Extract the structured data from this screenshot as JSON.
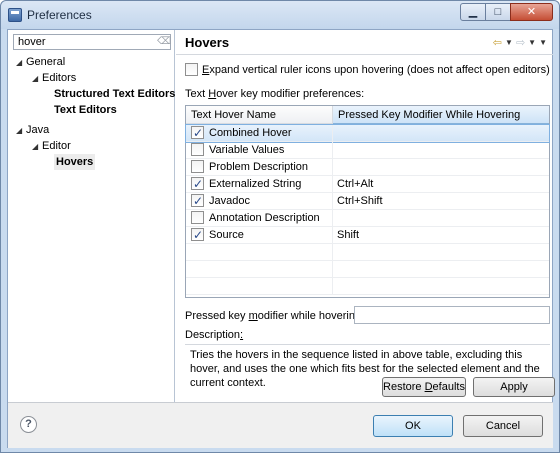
{
  "window": {
    "title": "Preferences",
    "min": "▁",
    "max": "□",
    "close": "✕"
  },
  "filter": {
    "value": "hover"
  },
  "tree": [
    {
      "label": "General",
      "level": 0,
      "twisty": "◢",
      "bold": false
    },
    {
      "label": "Editors",
      "level": 1,
      "twisty": "◢",
      "bold": false
    },
    {
      "label": "Structured Text Editors",
      "level": 2,
      "twisty": "",
      "bold": true
    },
    {
      "label": "Text Editors",
      "level": 2,
      "twisty": "",
      "bold": true
    },
    {
      "label": "Java",
      "level": 0,
      "twisty": "◢",
      "bold": false
    },
    {
      "label": "Editor",
      "level": 1,
      "twisty": "◢",
      "bold": false
    },
    {
      "label": "Hovers",
      "level": 2,
      "twisty": "",
      "bold": true,
      "selected": true
    }
  ],
  "page": {
    "title": "Hovers",
    "expand_label_pre": "",
    "expand_label_u": "E",
    "expand_label_post": "xpand vertical ruler icons upon hovering (does not affect open editors)",
    "table_label_pre": "Text ",
    "table_label_u": "H",
    "table_label_post": "over key modifier preferences:",
    "columns": [
      "Text Hover Name",
      "Pressed Key Modifier While Hovering"
    ],
    "rows": [
      {
        "name": "Combined Hover",
        "modifier": "",
        "checked": true,
        "selected": true
      },
      {
        "name": "Variable Values",
        "modifier": "",
        "checked": false
      },
      {
        "name": "Problem Description",
        "modifier": "",
        "checked": false
      },
      {
        "name": "Externalized String",
        "modifier": "Ctrl+Alt",
        "checked": true
      },
      {
        "name": "Javadoc",
        "modifier": "Ctrl+Shift",
        "checked": true
      },
      {
        "name": "Annotation Description",
        "modifier": "",
        "checked": false
      },
      {
        "name": "Source",
        "modifier": "Shift",
        "checked": true
      }
    ],
    "pressed_label_pre": "Pressed key ",
    "pressed_label_u": "m",
    "pressed_label_post": "odifier while hovering:",
    "pressed_value": "",
    "desc_label_pre": "Description",
    "desc_label_u": ":",
    "description": "Tries the hovers in the sequence listed in above table, excluding this hover, and uses the one which fits best for the selected element and the current context.",
    "restore_pre": "Restore ",
    "restore_u": "D",
    "restore_post": "efaults",
    "apply_label": "Apply"
  },
  "footer": {
    "ok": "OK",
    "cancel": "Cancel",
    "help": "?"
  },
  "colors": {
    "selection": "#d3e6f8",
    "title_bg": "#c9dbef",
    "close": "#c54e35"
  }
}
